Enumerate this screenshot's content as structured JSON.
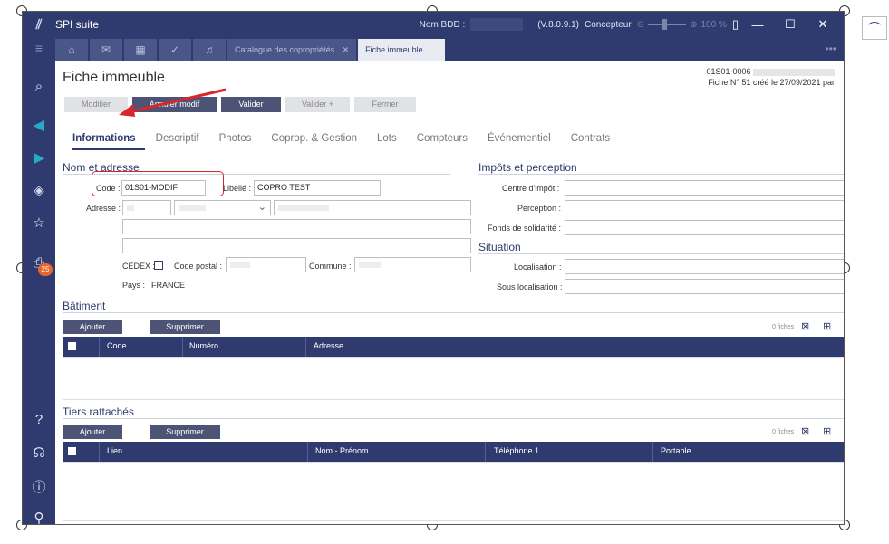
{
  "app": {
    "title": "SPI suite",
    "db_label": "Nom BDD :",
    "version": "(V.8.0.9.1)",
    "user": "Concepteur",
    "zoom": "100 %"
  },
  "tabs": [
    {
      "label": "Catalogue des copropriétés",
      "close": "✕"
    },
    {
      "label": "Fiche immeuble"
    }
  ],
  "sidebar": {
    "badge": "25"
  },
  "page": {
    "title": "Fiche immeuble",
    "ref": "01S01-0006",
    "created": "Fiche N° 51 créé le 27/09/2021 par"
  },
  "toolbar": {
    "modifier": "Modifier",
    "annuler": "Annuler modif",
    "valider": "Valider",
    "valider_plus": "Valider +",
    "fermer": "Fermer"
  },
  "nav_tabs": [
    "Informations",
    "Descriptif",
    "Photos",
    "Coprop. & Gestion",
    "Lots",
    "Compteurs",
    "Événementiel",
    "Contrats"
  ],
  "nom_adresse": {
    "title": "Nom et adresse",
    "code_label": "Code :",
    "code_value": "01S01-MODIF",
    "libelle_label": "Libellé :",
    "libelle_value": "COPRO TEST",
    "adresse_label": "Adresse :",
    "cedex_label": "CEDEX :",
    "cp_label": "Code postal :",
    "commune_label": "Commune :",
    "pays_label": "Pays :",
    "pays_value": "FRANCE"
  },
  "impots": {
    "title": "Impôts et perception",
    "centre": "Centre d'impôt :",
    "perception": "Perception :",
    "fonds": "Fonds de solidarité :"
  },
  "situation": {
    "title": "Situation",
    "localisation": "Localisation :",
    "sous_localisation": "Sous localisation :"
  },
  "batiment": {
    "title": "Bâtiment",
    "add": "Ajouter",
    "delete": "Supprimer",
    "count": "0 fiches",
    "columns": [
      "Code",
      "Numéro",
      "Adresse"
    ]
  },
  "tiers": {
    "title": "Tiers rattachés",
    "add": "Ajouter",
    "delete": "Supprimer",
    "count": "0 fiches",
    "columns": [
      "Lien",
      "Nom - Prénom",
      "Téléphone 1",
      "Portable"
    ]
  },
  "colors": {
    "navy": "#2f3b6e",
    "accent": "#27a9c9",
    "red": "#d9262b",
    "badge": "#e8652b"
  }
}
